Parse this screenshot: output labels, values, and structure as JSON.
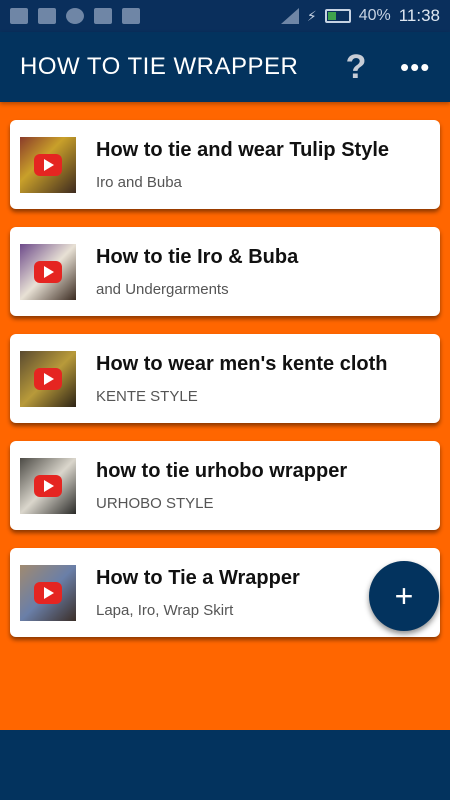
{
  "status_bar": {
    "battery": "40%",
    "time": "11:38"
  },
  "app_bar": {
    "title": "HOW TO TIE WRAPPER",
    "help_label": "?",
    "overflow_label": "⋮"
  },
  "items": [
    {
      "title": "How to tie and wear Tulip Style",
      "subtitle": "Iro and Buba"
    },
    {
      "title": "How to tie Iro & Buba",
      "subtitle": "and Undergarments"
    },
    {
      "title": "How to wear men's kente cloth",
      "subtitle": "KENTE STYLE"
    },
    {
      "title": "how to tie urhobo wrapper",
      "subtitle": "URHOBO STYLE"
    },
    {
      "title": "How to Tie a Wrapper",
      "subtitle": "Lapa, Iro, Wrap Skirt"
    }
  ],
  "fab": {
    "label": "+"
  },
  "colors": {
    "primary": "#03335e",
    "background": "#ff6600",
    "play": "#e52521"
  }
}
